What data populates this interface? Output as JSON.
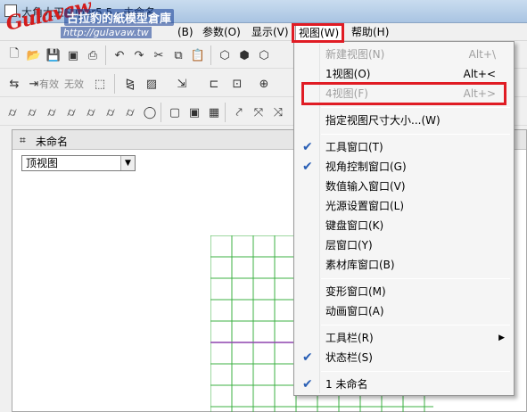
{
  "window": {
    "title": "大角大王Super5.5 - 未命名"
  },
  "watermark": {
    "logo": "Gulavaw",
    "site_name": "古拉豹的紙模型倉庫",
    "url": "http://gulavaw.tw"
  },
  "menubar": {
    "items": [
      {
        "label": "(B)"
      },
      {
        "label": "参数(O)"
      },
      {
        "label": "显示(V)"
      },
      {
        "label": "视图(W)"
      },
      {
        "label": "帮助(H)"
      }
    ]
  },
  "toolbar2": {
    "valid_label": "有效",
    "invalid_label": "无效"
  },
  "document": {
    "title": "未命名",
    "view_select": "顶视图"
  },
  "view_menu": {
    "items": [
      {
        "label": "新建视图(N)",
        "shortcut": "Alt+\\",
        "disabled": true,
        "checked": false
      },
      {
        "label": "1视图(O)",
        "shortcut": "Alt+<",
        "disabled": false,
        "checked": false
      },
      {
        "label": "4视图(F)",
        "shortcut": "Alt+>",
        "disabled": true,
        "checked": false
      },
      {
        "label": "指定视图尺寸大小...(W)",
        "shortcut": "",
        "disabled": false,
        "checked": false
      },
      {
        "label": "工具窗口(T)",
        "shortcut": "",
        "disabled": false,
        "checked": true
      },
      {
        "label": "视角控制窗口(G)",
        "shortcut": "",
        "disabled": false,
        "checked": true
      },
      {
        "label": "数值输入窗口(V)",
        "shortcut": "",
        "disabled": false,
        "checked": false
      },
      {
        "label": "光源设置窗口(L)",
        "shortcut": "",
        "disabled": false,
        "checked": false
      },
      {
        "label": "键盘窗口(K)",
        "shortcut": "",
        "disabled": false,
        "checked": false
      },
      {
        "label": "层窗口(Y)",
        "shortcut": "",
        "disabled": false,
        "checked": false
      },
      {
        "label": "素材库窗口(B)",
        "shortcut": "",
        "disabled": false,
        "checked": false
      },
      {
        "label": "变形窗口(M)",
        "shortcut": "",
        "disabled": false,
        "checked": false
      },
      {
        "label": "动画窗口(A)",
        "shortcut": "",
        "disabled": false,
        "checked": false
      },
      {
        "label": "工具栏(R)",
        "shortcut": "",
        "disabled": false,
        "checked": false,
        "submenu": true
      },
      {
        "label": "状态栏(S)",
        "shortcut": "",
        "disabled": false,
        "checked": true
      },
      {
        "label": "1 未命名",
        "shortcut": "",
        "disabled": false,
        "checked": true
      }
    ]
  },
  "colors": {
    "highlight": "#e01c24",
    "checkmark": "#2a5fb5",
    "grid": "#3cb043",
    "grid_axis": "#8e44ad"
  }
}
